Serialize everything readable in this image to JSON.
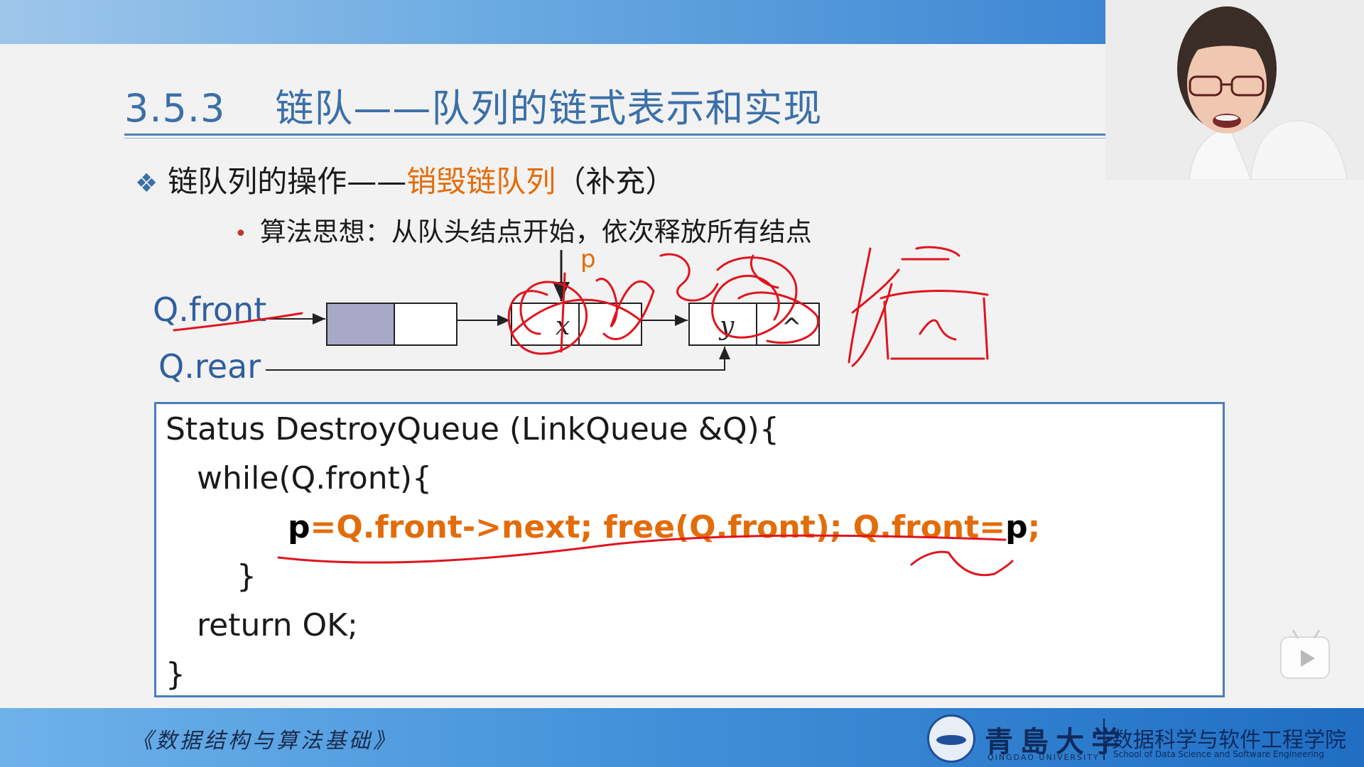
{
  "slide": {
    "title_number": "3.5.3",
    "title_text": "链队——队列的链式表示和实现",
    "bullet": {
      "prefix": "链队列的操作——",
      "highlight": "销毁链队列",
      "suffix": "（补充）"
    },
    "sub_bullet": "算法思想：从队头结点开始，依次释放所有结点"
  },
  "diagram": {
    "front_label": "Q.front",
    "rear_label": "Q.rear",
    "pointer_label": "p",
    "node1_value": "x",
    "node2_value": "y",
    "null_symbol": "^"
  },
  "code": {
    "line1": "Status DestroyQueue (LinkQueue &Q){",
    "line2": "while(Q.front){",
    "line3_p1": "p",
    "line3_mid": "=Q.front->next;  free(Q.front);  Q.front=",
    "line3_p2": "p",
    "line3_end": ";",
    "line4": "}",
    "line5": "return OK;",
    "line6": "}"
  },
  "footer": {
    "course": "《数据结构与算法基础》",
    "university_cn": "青島大学",
    "university_en": "QINGDAO UNIVERSITY",
    "school_cn": "数据科学与软件工程学院",
    "school_en": "School of Data Science and Software Engineering"
  },
  "colors": {
    "title": "#3b6fa8",
    "highlight": "#e36c0a",
    "annotation": "#e0141e",
    "node_fill": "#aaa8c9"
  }
}
